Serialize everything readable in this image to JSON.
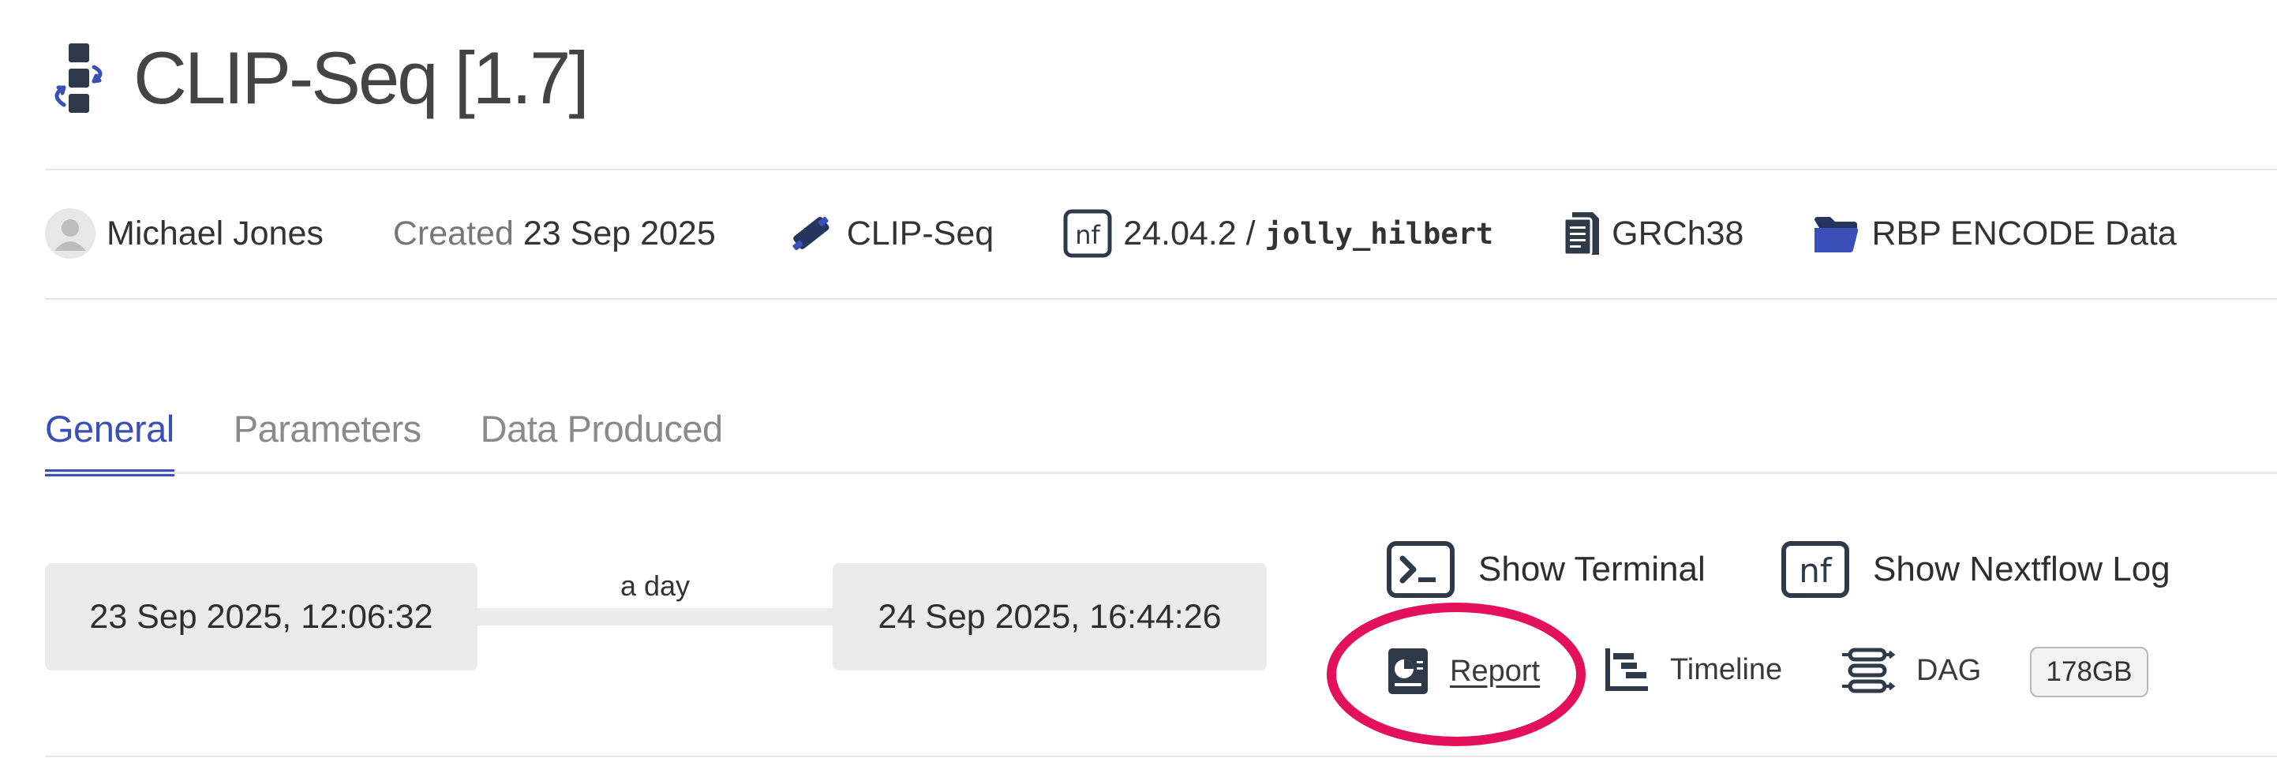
{
  "header": {
    "title": "CLIP-Seq [1.7]",
    "title_icon": "pipeline-icon"
  },
  "meta": {
    "user": "Michael Jones",
    "created_label": "Created",
    "created_date": "23 Sep 2025",
    "pipeline": "CLIP-Seq",
    "nextflow_version": "24.04.2 /",
    "run_name": "jolly_hilbert",
    "genome": "GRCh38",
    "project": "RBP ENCODE Data"
  },
  "tabs": [
    {
      "label": "General",
      "active": true
    },
    {
      "label": "Parameters",
      "active": false
    },
    {
      "label": "Data Produced",
      "active": false
    }
  ],
  "timing": {
    "start": "23 Sep 2025, 12:06:32",
    "end": "24 Sep 2025, 16:44:26",
    "duration": "a day"
  },
  "actions": {
    "terminal_label": "Show Terminal",
    "nextflow_log_label": "Show Nextflow Log",
    "report_label": "Report",
    "timeline_label": "Timeline",
    "dag_label": "DAG",
    "size": "178GB"
  },
  "colors": {
    "accent": "#3a4fb8",
    "highlight": "#e3105a",
    "chip_bg": "#ebebec",
    "icon_dark": "#2f3a48"
  }
}
